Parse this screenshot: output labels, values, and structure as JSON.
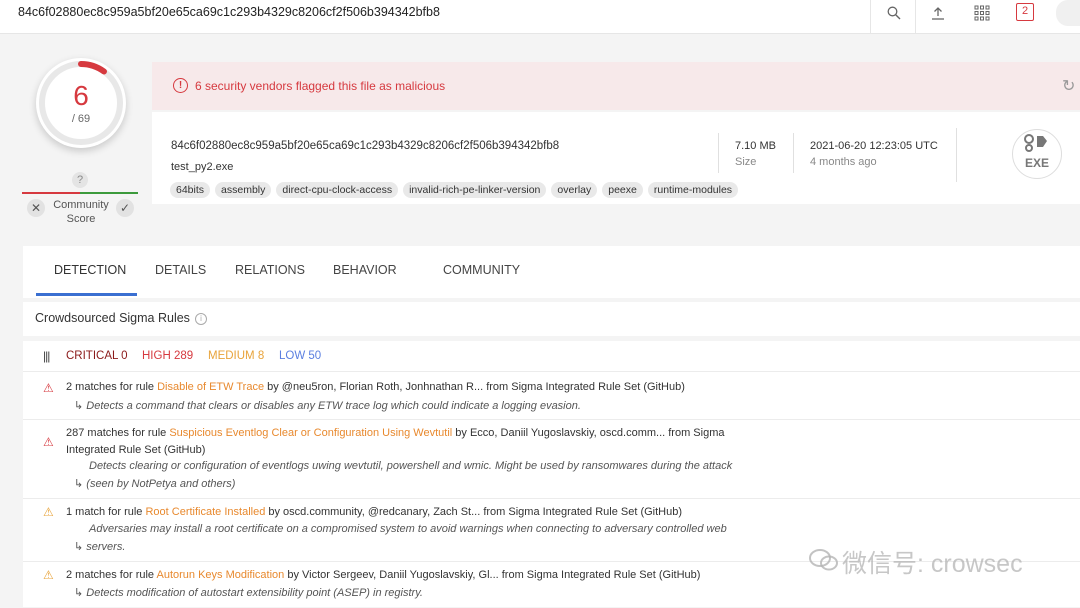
{
  "topbar": {
    "search_value": "84c6f02880ec8c959a5bf20e65ca69c1c293b4329c8206cf2f506b394342bfb8",
    "notification_count": "2"
  },
  "score": {
    "detections": "6",
    "total": "/ 69",
    "community_question": "?",
    "community_label": "Community Score"
  },
  "banner": {
    "message": "6 security vendors flagged this file as malicious"
  },
  "file": {
    "hash": "84c6f02880ec8c959a5bf20e65ca69c1c293b4329c8206cf2f506b394342bfb8",
    "name": "test_py2.exe",
    "size_value": "7.10 MB",
    "size_label": "Size",
    "date_value": "2021-06-20 12:23:05 UTC",
    "date_label": "4 months ago",
    "type_badge": "EXE",
    "tags": [
      "64bits",
      "assembly",
      "direct-cpu-clock-access",
      "invalid-rich-pe-linker-version",
      "overlay",
      "peexe",
      "runtime-modules"
    ]
  },
  "tabs": [
    "DETECTION",
    "DETAILS",
    "RELATIONS",
    "BEHAVIOR",
    "COMMUNITY"
  ],
  "sigma": {
    "title": "Crowdsourced Sigma Rules",
    "critical": "CRITICAL 0",
    "high": "HIGH 289",
    "medium": "MEDIUM 8",
    "low": "LOW 50",
    "rules": [
      {
        "prefix": "2 matches for rule ",
        "rule": "Disable of ETW Trace",
        "suffix": " by @neu5ron, Florian Roth, Jonhnathan R...   from Sigma Integrated Rule Set (GitHub)",
        "desc": "Detects a command that clears or disables any ETW trace log which could indicate a logging evasion."
      },
      {
        "prefix": "287 matches for rule ",
        "rule": "Suspicious Eventlog Clear or Configuration Using Wevtutil",
        "suffix": " by Ecco, Daniil Yugoslavskiy, oscd.comm...   from Sigma",
        "suffix2": "Integrated Rule Set (GitHub)",
        "desc": "Detects clearing or configuration of eventlogs uwing wevtutil, powershell and wmic. Might be used by ransomwares during the attack",
        "desc2": "(seen by NotPetya and others)"
      },
      {
        "prefix": "1 match for rule ",
        "rule": "Root Certificate Installed",
        "suffix": " by oscd.community, @redcanary, Zach St...  from Sigma Integrated Rule Set (GitHub)",
        "desc": "Adversaries may install a root certificate on a compromised system to avoid warnings when connecting to adversary controlled web",
        "desc2": "servers."
      },
      {
        "prefix": "2 matches for rule ",
        "rule": "Autorun Keys Modification",
        "suffix": " by Victor Sergeev, Daniil Yugoslavskiy, Gl...   from Sigma Integrated Rule Set (GitHub)",
        "desc": "Detects modification of autostart extensibility point (ASEP) in registry."
      }
    ]
  },
  "watermark": "微信号: crowsec",
  "colors": {
    "malicious": "#d6393f",
    "rule_link": "#e8892e",
    "tab_accent": "#3a6fd1",
    "medium": "#e8a33a",
    "low": "#5b7fe0"
  }
}
